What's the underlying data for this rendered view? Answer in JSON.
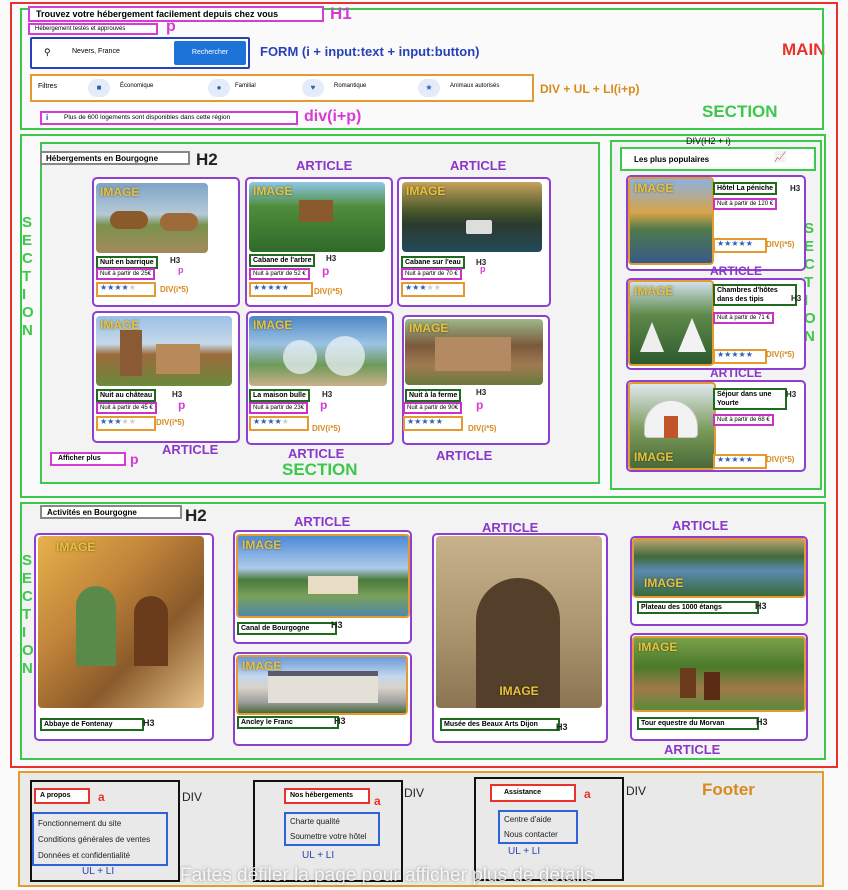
{
  "header": {
    "title": "Trouvez votre hébergement facilement depuis chez vous",
    "title_tag": "H1",
    "subtitle": "Hébergement testés et approuvés",
    "subtitle_tag": "p"
  },
  "form": {
    "location_value": "Nevers, France",
    "button_label": "Rechercher",
    "annotation": "FORM (i + input:text + input:button)"
  },
  "main_label": "MAIN",
  "filters": {
    "label": "Filtres",
    "items": [
      "Économique",
      "Familial",
      "Romantique",
      "Animaux autorisés"
    ],
    "annotation": "DIV + UL + LI(i+p)"
  },
  "section_label": "SECTION",
  "info": {
    "text": "Plus de 600 logements sont disponibles dans cette région",
    "annotation": "div(i+p)"
  },
  "hebergements": {
    "title": "Hébergements en Bourgogne",
    "title_tag": "H2",
    "article_label": "ARTICLE",
    "image_label": "IMAGE",
    "h3_label": "H3",
    "p_label": "p",
    "stars_label": "DIV(i*5)",
    "cards": [
      {
        "name": "Nuit en barrique",
        "price": "Nuit à partir de 25€",
        "rating": 4
      },
      {
        "name": "Cabane de l'arbre",
        "price": "Nuit à partir de 52 €",
        "rating": 5
      },
      {
        "name": "Cabane sur l'eau",
        "price": "Nuit à partir de 70 €",
        "rating": 3
      },
      {
        "name": "Nuit au château",
        "price": "Nuit à partir de 45 €",
        "rating": 3
      },
      {
        "name": "La maison bulle",
        "price": "Nuit à partir de 23€",
        "rating": 4
      },
      {
        "name": "Nuit à la ferme",
        "price": "Nuit à partir de 90€",
        "rating": 5
      }
    ],
    "more_button": "Afficher plus",
    "section_bottom_label": "SECTION"
  },
  "populaires": {
    "title": "Les plus populaires",
    "annotation": "DIV(H2 + i)",
    "cards": [
      {
        "name": "Hôtel La péniche",
        "price": "Nuit à partir de 120 €",
        "rating": 5
      },
      {
        "name": "Chambres d'hôtes dans des tipis",
        "price": "Nuit à partir de 71 €",
        "rating": 5
      },
      {
        "name": "Séjour dans une Yourte",
        "price": "Nuit à partir de 68 €",
        "rating": 5
      }
    ]
  },
  "activites": {
    "title": "Activités en Bourgogne",
    "title_tag": "H2",
    "items": [
      "Abbaye de Fontenay",
      "Canal de Bourgogne",
      "Ancley le Franc",
      "Musée des Beaux Arts Dijon",
      "Plateau des 1000 étangs",
      "Tour equestre du Morvan"
    ]
  },
  "footer": {
    "label": "Footer",
    "div_label": "DIV",
    "a_label": "a",
    "ul_label": "UL + LI",
    "columns": [
      {
        "title": "A propos",
        "links": [
          "Fonctionnement du site",
          "Conditions générales de ventes",
          "Données et confidentialité"
        ]
      },
      {
        "title": "Nos hébergements",
        "links": [
          "Charte qualité",
          "Soumettre votre hôtel"
        ]
      },
      {
        "title": "Assistance",
        "links": [
          "Centre d'aide",
          "Nous contacter"
        ]
      }
    ]
  },
  "watermark": "Faites défiler la page pour afficher plus de détails",
  "section_vertical": "SECTION"
}
